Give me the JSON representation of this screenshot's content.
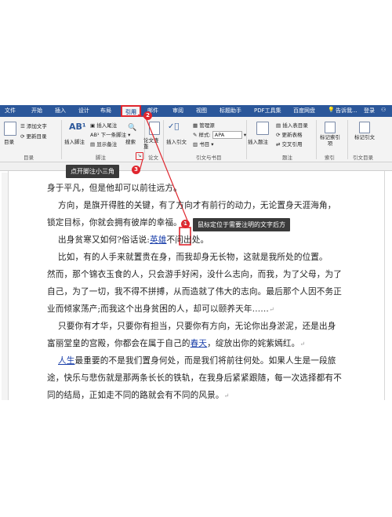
{
  "tabs": [
    "文件",
    "开始",
    "插入",
    "设计",
    "布局",
    "引用",
    "邮件",
    "审阅",
    "视图",
    "标题助手",
    "PDF工具集",
    "百度网盘"
  ],
  "active_tab": "引用",
  "tell_me": "告诉我...",
  "login": "登录",
  "ribbon": {
    "toc": "目录",
    "add_text": "添加文字",
    "update_toc": "更新目录",
    "insert_footnote": "插入脚注",
    "insert_endnote": "插入尾注",
    "next_footnote": "下一条脚注",
    "show_notes": "显示备注",
    "search": "搜索",
    "paper_lookup": "论文查重",
    "insert_citation": "插入引文",
    "manage_sources": "管理源",
    "style_label": "样式:",
    "style_value": "APA",
    "bibliography": "书目",
    "insert_caption": "插入题注",
    "insert_table_of_figures": "插入表目录",
    "update_table": "更新表格",
    "cross_reference": "交叉引用",
    "mark_entry": "标记索引项",
    "mark_citation": "标记引文"
  },
  "group_labels": {
    "toc": "目录",
    "footnotes": "脚注",
    "paper": "论文",
    "citations": "引文与书目",
    "captions": "题注",
    "index": "索引",
    "table_of_authorities": "引文目录"
  },
  "badges": [
    "1",
    "2",
    "3"
  ],
  "callouts": {
    "open_footnote": "点开脚注小三角",
    "position_cursor": "鼠标定位于需要注明的文字后方"
  },
  "doc": {
    "lines": [
      "身于平凡，但是他却可以前往远方。",
      "方向，是旗开得胜的关键，有了方向才有前行的动力，无论置身天涯海角，",
      "锁定目标，你就会拥有彼岸的幸福。",
      "比如，有的人手来就置贵在身，而我却身无长物，这就是我所处的位置。",
      "然而，那个锦衣玉食的人，只会游手好闲，没什么志向，而我，为了父母，为了",
      "自己，为了一切，我不得不拼搏，从而造就了伟大的志向。最后那个人因不务正",
      "业而倾家荡产;而我这个出身贫困的人，却可以颐养天年……",
      "只要你有才华，只要你有担当，只要你有方向，无论你出身淤泥，还是出身",
      "富丽堂皇的宫殿，你都会在属于自己的",
      "，绽放出你的姹紫嫣红。",
      "最重要的不是我们置身何处，而是我们将前往何处。如果人生是一段旅",
      "途，快乐与悲伤就是那两条长长的铁轨，在我身后紧紧跟随，每一次选择都有不",
      "同的结局，正如走不同的路就会有不同的风景。"
    ],
    "line_poor_pre": "出身贫寒又如何?俗话说:",
    "link_hero": "英雄",
    "line_poor_post": "不问出处。",
    "link_spring": "春天",
    "link_life": "人生"
  }
}
